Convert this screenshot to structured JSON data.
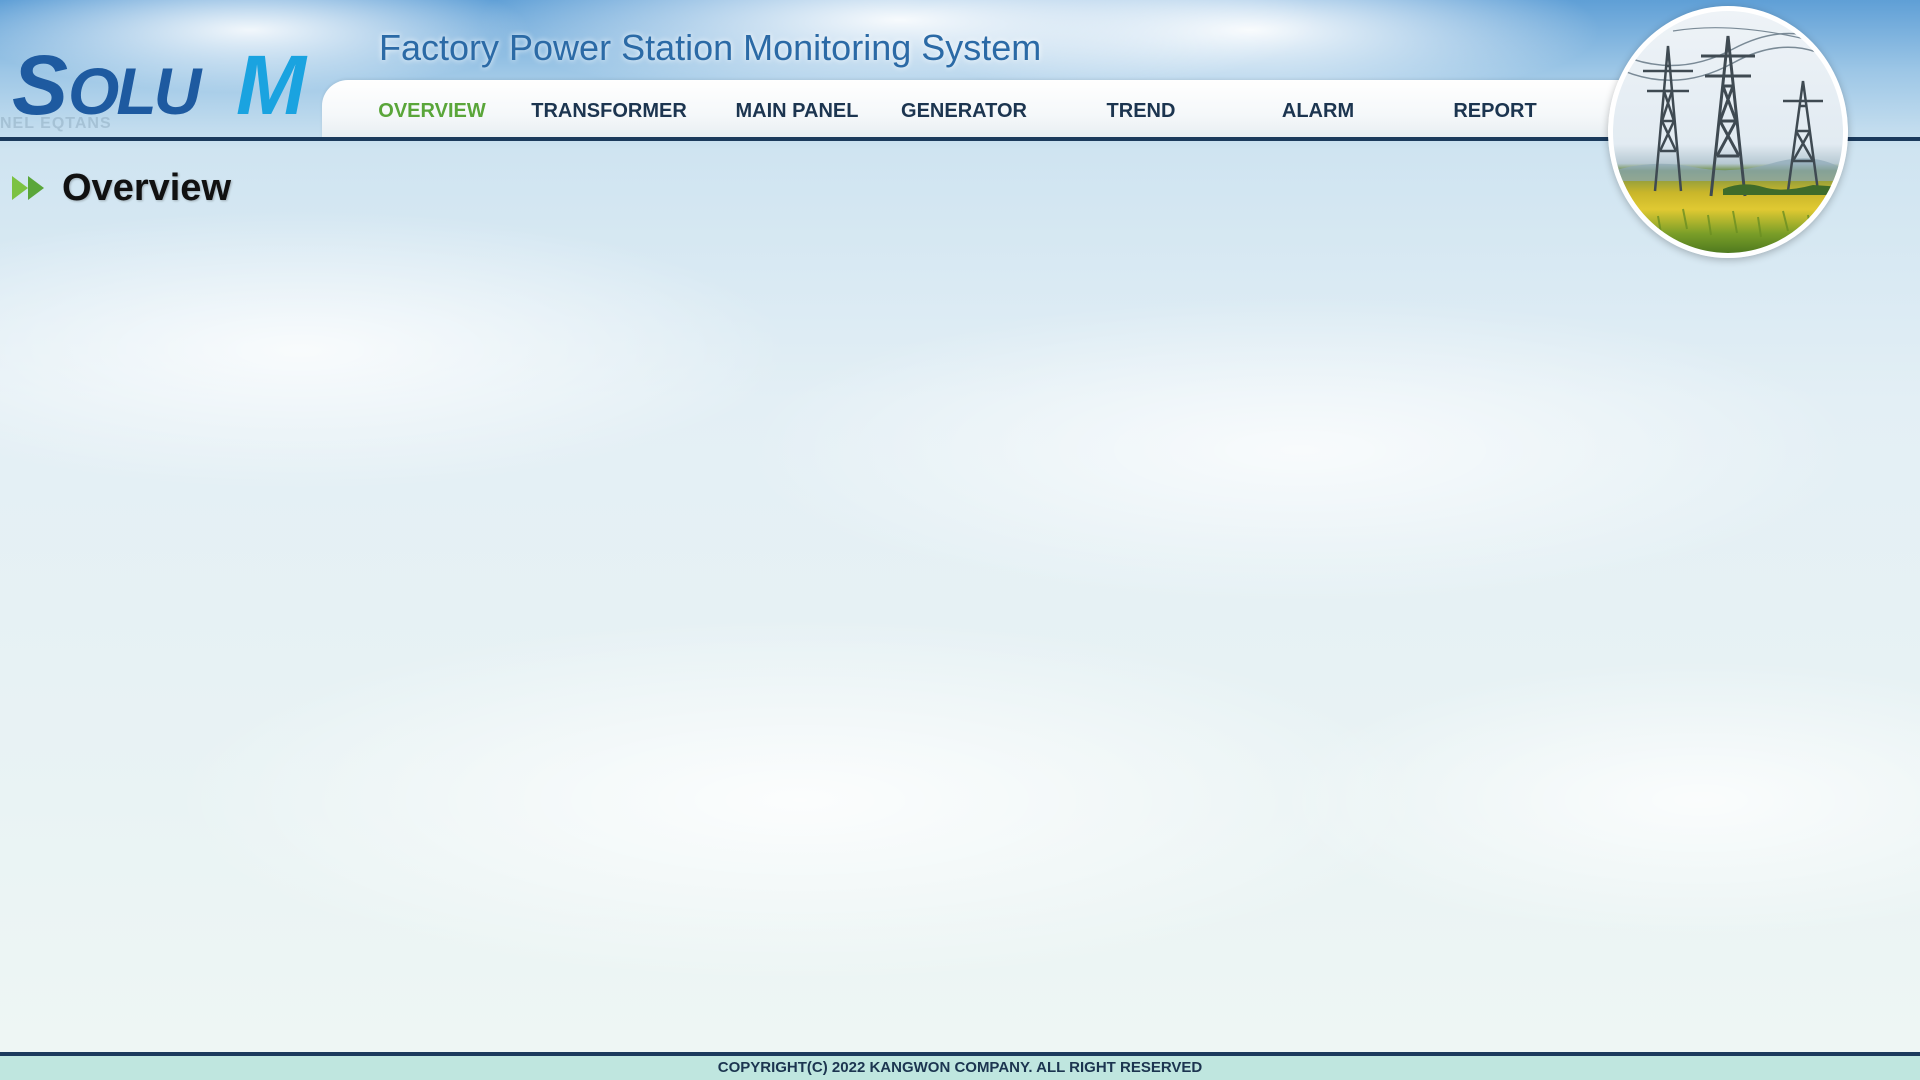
{
  "header": {
    "logo_text": "SOLU M",
    "logo_ghost_text": "NEL   EQTANS",
    "title": "Factory Power Station Monitoring System"
  },
  "nav": {
    "items": [
      {
        "label": "OVERVIEW",
        "active": true
      },
      {
        "label": "TRANSFORMER",
        "active": false
      },
      {
        "label": "MAIN PANEL",
        "active": false
      },
      {
        "label": "GENERATOR",
        "active": false
      },
      {
        "label": "TREND",
        "active": false
      },
      {
        "label": "ALARM",
        "active": false
      },
      {
        "label": "REPORT",
        "active": false
      }
    ]
  },
  "page": {
    "title": "Overview",
    "heading_icon": "double-chevron-right-icon"
  },
  "decor": {
    "image": "power-pylons-field-image"
  },
  "footer": {
    "copyright": "COPYRIGHT(C) 2022 KANGWON COMPANY. ALL RIGHT RESERVED"
  },
  "colors": {
    "title_blue": "#2b6aa6",
    "nav_active_green": "#5aa63a",
    "nav_text": "#1c3550",
    "header_rule": "#1b3a5c",
    "logo_dark_blue": "#1e5aa0",
    "logo_light_blue": "#1aa3e0",
    "footer_bg": "#bfe6df"
  }
}
